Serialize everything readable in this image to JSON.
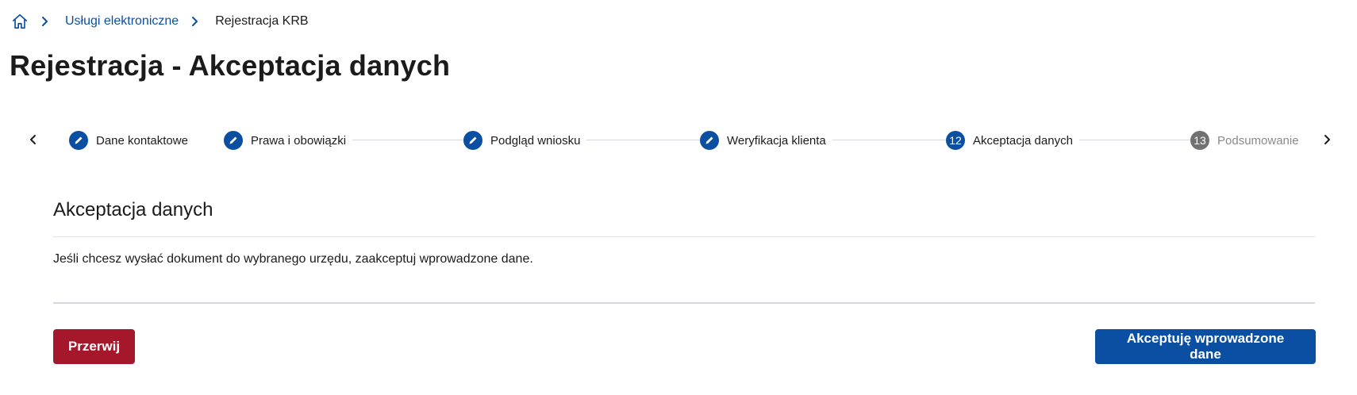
{
  "breadcrumb": {
    "home_icon": "home-icon",
    "items": [
      {
        "label": "Usługi elektroniczne"
      },
      {
        "label": "Rejestracja KRB"
      }
    ]
  },
  "page": {
    "title": "Rejestracja - Akceptacja danych"
  },
  "stepper": {
    "prev_icon": "chevron-left-icon",
    "next_icon": "chevron-right-icon",
    "steps": [
      {
        "label": "Dane kontaktowe",
        "state": "completed",
        "badge_icon": "pencil-icon",
        "number": ""
      },
      {
        "label": "Prawa i obowiązki",
        "state": "completed",
        "badge_icon": "pencil-icon",
        "number": ""
      },
      {
        "label": "Podgląd wniosku",
        "state": "completed",
        "badge_icon": "pencil-icon",
        "number": ""
      },
      {
        "label": "Weryfikacja klienta",
        "state": "completed",
        "badge_icon": "pencil-icon",
        "number": ""
      },
      {
        "label": "Akceptacja danych",
        "state": "active",
        "number": "12"
      },
      {
        "label": "Podsumowanie",
        "state": "upcoming",
        "number": "13"
      }
    ]
  },
  "section": {
    "title": "Akceptacja danych",
    "text": "Jeśli chcesz wysłać dokument do wybranego urzędu, zaakceptuj wprowadzone dane."
  },
  "actions": {
    "cancel_label": "Przerwij",
    "accept_label": "Akceptuję wprowadzone dane"
  },
  "colors": {
    "primary": "#0b4fa3",
    "danger": "#a5172b",
    "upcoming": "#727272",
    "link": "#0b4fa3"
  }
}
